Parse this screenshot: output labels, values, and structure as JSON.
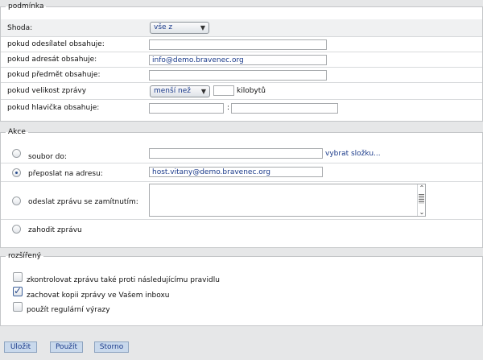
{
  "conditions": {
    "legend": "podmínka",
    "match_label": "Shoda:",
    "match_value": "vše z",
    "sender_label": "pokud odesílatel obsahuje:",
    "sender_value": "",
    "recipient_label": "pokud adresát obsahuje:",
    "recipient_value": "info@demo.bravenec.org",
    "subject_label": "pokud předmět obsahuje:",
    "subject_value": "",
    "size_label": "pokud velikost zprávy",
    "size_operator": "menší než",
    "size_value": "",
    "size_unit": "kilobytů",
    "header_label": "pokud hlavička obsahuje:",
    "header_name": "",
    "header_separator": ":",
    "header_value": ""
  },
  "actions": {
    "legend": "Akce",
    "file_label": "soubor do:",
    "file_value": "",
    "choose_folder": "vybrat složku...",
    "forward_label": "přeposlat na adresu:",
    "forward_value": "host.vitany@demo.bravenec.org",
    "reject_label": "odeslat zprávu se zamítnutím:",
    "reject_value": "",
    "discard_label": "zahodit zprávu",
    "selected": "forward"
  },
  "advanced": {
    "legend": "rozšířený",
    "options": [
      {
        "label": "zkontrolovat zprávu také proti následujícímu pravidlu",
        "checked": false
      },
      {
        "label": "zachovat kopii zprávy ve Vašem inboxu",
        "checked": true
      },
      {
        "label": "použít regulární výrazy",
        "checked": false
      }
    ]
  },
  "buttons": {
    "save": "Uložit",
    "apply": "Použít",
    "cancel": "Storno"
  }
}
